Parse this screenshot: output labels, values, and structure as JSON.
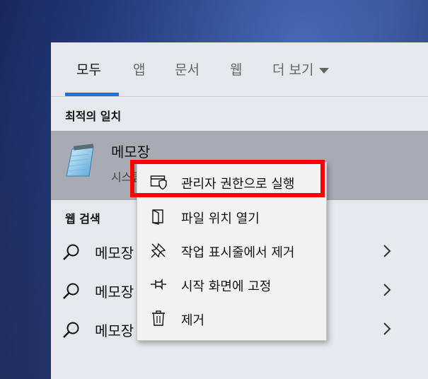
{
  "tabs": [
    {
      "label": "모두",
      "active": true
    },
    {
      "label": "앱",
      "active": false
    },
    {
      "label": "문서",
      "active": false
    },
    {
      "label": "웹",
      "active": false
    },
    {
      "label": "더 보기",
      "active": false
    }
  ],
  "best_match": {
    "title": "최적의 일치",
    "app_name": "메모장",
    "app_type": "시스템",
    "icon": "notepad-icon"
  },
  "web_search": {
    "title": "웹 검색",
    "items": [
      {
        "text": "메모장"
      },
      {
        "text": "메모장"
      },
      {
        "text": "메모장"
      }
    ]
  },
  "context_menu": {
    "items": [
      {
        "label": "관리자 권한으로 실행",
        "icon": "shield-admin-icon"
      },
      {
        "label": "파일 위치 열기",
        "icon": "file-location-icon"
      },
      {
        "label": "작업 표시줄에서 제거",
        "icon": "unpin-taskbar-icon"
      },
      {
        "label": "시작 화면에 고정",
        "icon": "pin-icon"
      },
      {
        "label": "제거",
        "icon": "trash-icon"
      }
    ]
  },
  "colors": {
    "accent": "#1a73d9",
    "highlight": "#ff0000",
    "selected_row": "#a9abb4"
  }
}
